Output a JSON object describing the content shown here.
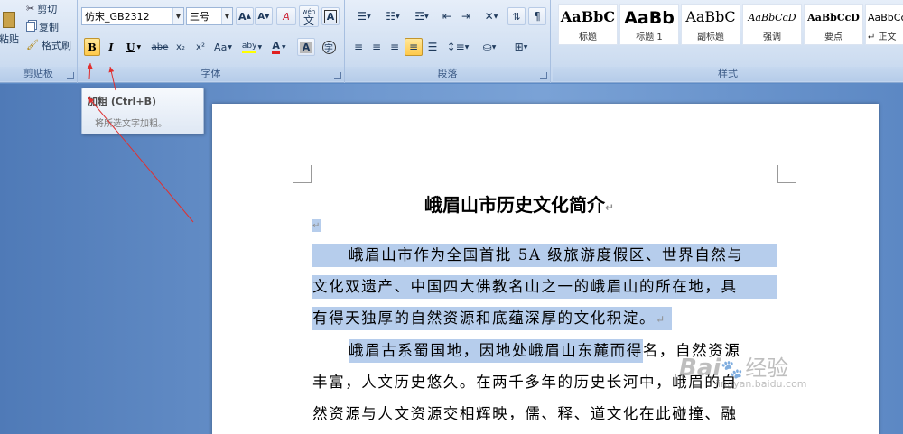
{
  "clipboard": {
    "paste_label": "粘贴",
    "cut_label": "剪切",
    "copy_label": "复制",
    "format_painter_label": "格式刷",
    "group_label": "剪贴板"
  },
  "font": {
    "font_name": "仿宋_GB2312",
    "font_size": "三号",
    "grow_label": "A",
    "shrink_label": "A",
    "clear_label": "A",
    "phonetic_label": "wén",
    "phonetic_char": "文",
    "char_border_label": "A",
    "bold_label": "B",
    "italic_label": "I",
    "underline_label": "U",
    "strike_label": "abe",
    "subscript_label": "x₂",
    "superscript_label": "x²",
    "case_label": "Aa",
    "highlight_label": "aby",
    "font_color_label": "A",
    "shading_label": "A",
    "enclose_label": "字",
    "group_label": "字体"
  },
  "paragraph": {
    "group_label": "段落"
  },
  "styles": {
    "group_label": "样式",
    "items": [
      {
        "sample": "AaBbC",
        "name": "标题"
      },
      {
        "sample": "AaBb",
        "name": "标题 1"
      },
      {
        "sample": "AaBbC",
        "name": "副标题"
      },
      {
        "sample": "AaBbCcD",
        "name": "强调"
      },
      {
        "sample": "AaBbCcD",
        "name": "要点"
      },
      {
        "sample": "AaBbCc",
        "name": "↵ 正文"
      }
    ]
  },
  "tooltip": {
    "title": "加粗 (Ctrl+B)",
    "description": "将所选文字加粗。"
  },
  "document": {
    "title": "峨眉山市历史文化简介",
    "return_mark": "↵",
    "lines": [
      "峨眉山市作为全国首批 5A 级旅游度假区、世界自然与",
      "文化双遗产、中国四大佛教名山之一的峨眉山的所在地，具",
      "有得天独厚的自然资源和底蕴深厚的文化积淀。",
      "峨眉古系蜀国地，因地处峨眉山东麓而得",
      "名，自然资源",
      "丰富，人文历史悠久。在两千多年的历史长河中，峨眉的自",
      "然资源与人文资源交相辉映，儒、释、道文化在此碰撞、融"
    ]
  },
  "watermark": {
    "logo_text": "Bai",
    "brand_cn": "经验",
    "site": "jingyan.baidu.com"
  },
  "colors": {
    "accent_selection": "#b6cdec",
    "pressed_button": "#ffc94a",
    "ribbon_bg": "#dbe6f4",
    "annotation_arrow": "#e03030"
  }
}
